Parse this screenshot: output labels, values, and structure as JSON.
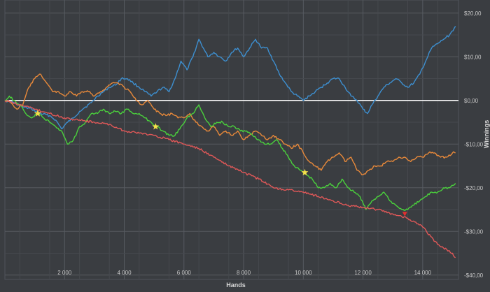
{
  "chart_data": {
    "type": "line",
    "title": "",
    "xlabel": "Hands",
    "ylabel": "Winnings",
    "xlim": [
      0,
      15200
    ],
    "ylim": [
      -41,
      23
    ],
    "x_ticks": [
      2000,
      4000,
      6000,
      8000,
      10000,
      12000,
      14000
    ],
    "x_tick_labels": [
      "2 000",
      "4 000",
      "6 000",
      "8 000",
      "10 000",
      "12 000",
      "14 000"
    ],
    "y_ticks": [
      20,
      10,
      0,
      -10,
      -20,
      -30,
      -40
    ],
    "y_tick_labels": [
      "$20,00",
      "$10,00",
      "$0,00",
      "-$10,00",
      "-$20,00",
      "-$30,00",
      "-$40,00"
    ],
    "grid": true,
    "zero_line_color": "#ffffff",
    "background": "#3a3d41",
    "series": [
      {
        "color": "#3d8fd0",
        "points": [
          [
            0,
            0
          ],
          [
            300,
            -0.5
          ],
          [
            600,
            -1.5
          ],
          [
            900,
            -2
          ],
          [
            1200,
            -3
          ],
          [
            1500,
            -3.5
          ],
          [
            1700,
            -4.5
          ],
          [
            1900,
            -6.5
          ],
          [
            2100,
            -5
          ],
          [
            2300,
            -4
          ],
          [
            2500,
            -2.5
          ],
          [
            2700,
            -1.5
          ],
          [
            2900,
            -0.5
          ],
          [
            3100,
            1
          ],
          [
            3300,
            2
          ],
          [
            3500,
            3
          ],
          [
            3700,
            3.5
          ],
          [
            3900,
            5
          ],
          [
            4100,
            5
          ],
          [
            4300,
            4
          ],
          [
            4500,
            3
          ],
          [
            4700,
            2
          ],
          [
            4900,
            1
          ],
          [
            5100,
            2
          ],
          [
            5300,
            3
          ],
          [
            5500,
            2
          ],
          [
            5700,
            5
          ],
          [
            5900,
            9
          ],
          [
            6100,
            7
          ],
          [
            6300,
            10
          ],
          [
            6500,
            14
          ],
          [
            6650,
            12
          ],
          [
            6800,
            10
          ],
          [
            7000,
            11
          ],
          [
            7200,
            10
          ],
          [
            7400,
            9
          ],
          [
            7600,
            11
          ],
          [
            7800,
            12
          ],
          [
            8000,
            10
          ],
          [
            8200,
            12
          ],
          [
            8400,
            14
          ],
          [
            8600,
            12
          ],
          [
            8800,
            12
          ],
          [
            9000,
            9
          ],
          [
            9200,
            6
          ],
          [
            9400,
            4
          ],
          [
            9600,
            2
          ],
          [
            9800,
            1
          ],
          [
            10000,
            0
          ],
          [
            10200,
            1
          ],
          [
            10400,
            2
          ],
          [
            10600,
            3
          ],
          [
            10800,
            4
          ],
          [
            11000,
            5
          ],
          [
            11200,
            5
          ],
          [
            11400,
            3
          ],
          [
            11600,
            1
          ],
          [
            11800,
            0
          ],
          [
            12000,
            -2
          ],
          [
            12150,
            -3
          ],
          [
            12300,
            -1
          ],
          [
            12500,
            1
          ],
          [
            12700,
            3
          ],
          [
            12900,
            4
          ],
          [
            13100,
            5
          ],
          [
            13300,
            4
          ],
          [
            13500,
            3
          ],
          [
            13700,
            4
          ],
          [
            13900,
            6
          ],
          [
            14100,
            9
          ],
          [
            14300,
            12
          ],
          [
            14500,
            13
          ],
          [
            14700,
            14
          ],
          [
            14900,
            15
          ],
          [
            15100,
            17
          ]
        ]
      },
      {
        "color": "#e8893a",
        "points": [
          [
            0,
            0
          ],
          [
            200,
            -0.5
          ],
          [
            400,
            -2
          ],
          [
            600,
            -1
          ],
          [
            800,
            3
          ],
          [
            1000,
            5
          ],
          [
            1200,
            6
          ],
          [
            1400,
            4
          ],
          [
            1600,
            2
          ],
          [
            1800,
            2
          ],
          [
            2000,
            1
          ],
          [
            2200,
            2
          ],
          [
            2400,
            1
          ],
          [
            2600,
            2
          ],
          [
            2800,
            2
          ],
          [
            3000,
            1
          ],
          [
            3200,
            2
          ],
          [
            3400,
            3
          ],
          [
            3600,
            4
          ],
          [
            3800,
            4
          ],
          [
            4000,
            3
          ],
          [
            4200,
            2
          ],
          [
            4400,
            0
          ],
          [
            4600,
            -1
          ],
          [
            4800,
            0
          ],
          [
            5000,
            -2
          ],
          [
            5200,
            -3
          ],
          [
            5400,
            -3.5
          ],
          [
            5600,
            -3
          ],
          [
            5800,
            -4
          ],
          [
            6000,
            -4
          ],
          [
            6200,
            -3
          ],
          [
            6400,
            -5
          ],
          [
            6600,
            -6
          ],
          [
            6800,
            -7
          ],
          [
            7000,
            -6
          ],
          [
            7200,
            -8
          ],
          [
            7400,
            -7
          ],
          [
            7600,
            -8
          ],
          [
            7800,
            -7
          ],
          [
            8000,
            -9
          ],
          [
            8200,
            -8
          ],
          [
            8400,
            -7
          ],
          [
            8600,
            -8
          ],
          [
            8800,
            -9
          ],
          [
            9000,
            -8
          ],
          [
            9200,
            -9
          ],
          [
            9400,
            -10
          ],
          [
            9600,
            -11
          ],
          [
            9800,
            -10
          ],
          [
            10000,
            -12
          ],
          [
            10200,
            -14
          ],
          [
            10400,
            -15
          ],
          [
            10600,
            -16
          ],
          [
            10800,
            -14
          ],
          [
            11000,
            -13
          ],
          [
            11200,
            -12
          ],
          [
            11400,
            -14
          ],
          [
            11600,
            -13
          ],
          [
            11800,
            -16
          ],
          [
            12000,
            -17
          ],
          [
            12200,
            -16
          ],
          [
            12400,
            -15
          ],
          [
            12600,
            -15
          ],
          [
            12800,
            -14
          ],
          [
            13000,
            -14
          ],
          [
            13200,
            -13
          ],
          [
            13400,
            -13
          ],
          [
            13600,
            -14
          ],
          [
            13800,
            -13
          ],
          [
            14000,
            -13
          ],
          [
            14200,
            -12
          ],
          [
            14400,
            -12
          ],
          [
            14600,
            -13
          ],
          [
            14800,
            -13
          ],
          [
            15000,
            -12
          ],
          [
            15100,
            -12
          ]
        ]
      },
      {
        "color": "#4ad13c",
        "points": [
          [
            0,
            0
          ],
          [
            150,
            1
          ],
          [
            300,
            0
          ],
          [
            500,
            -1
          ],
          [
            700,
            -3
          ],
          [
            900,
            -4
          ],
          [
            1100,
            -3
          ],
          [
            1300,
            -4
          ],
          [
            1500,
            -5
          ],
          [
            1700,
            -6
          ],
          [
            1900,
            -7
          ],
          [
            2100,
            -10
          ],
          [
            2300,
            -9
          ],
          [
            2500,
            -6
          ],
          [
            2700,
            -5
          ],
          [
            2900,
            -3
          ],
          [
            3100,
            -3
          ],
          [
            3300,
            -2
          ],
          [
            3500,
            -3
          ],
          [
            3700,
            -2.5
          ],
          [
            3900,
            -3
          ],
          [
            4100,
            -2
          ],
          [
            4300,
            -3
          ],
          [
            4500,
            -3
          ],
          [
            4700,
            -4
          ],
          [
            4900,
            -5
          ],
          [
            5100,
            -6
          ],
          [
            5300,
            -7
          ],
          [
            5500,
            -8
          ],
          [
            5700,
            -8
          ],
          [
            5900,
            -6
          ],
          [
            6100,
            -4
          ],
          [
            6300,
            -3
          ],
          [
            6500,
            -1
          ],
          [
            6700,
            -4
          ],
          [
            6900,
            -6
          ],
          [
            7100,
            -5
          ],
          [
            7300,
            -5
          ],
          [
            7500,
            -6
          ],
          [
            7700,
            -6
          ],
          [
            7900,
            -7
          ],
          [
            8100,
            -7
          ],
          [
            8300,
            -8
          ],
          [
            8500,
            -9
          ],
          [
            8700,
            -10
          ],
          [
            8900,
            -10
          ],
          [
            9100,
            -9
          ],
          [
            9300,
            -11
          ],
          [
            9500,
            -13
          ],
          [
            9700,
            -15
          ],
          [
            9900,
            -16
          ],
          [
            10100,
            -17
          ],
          [
            10300,
            -18
          ],
          [
            10500,
            -20
          ],
          [
            10700,
            -20
          ],
          [
            10900,
            -19
          ],
          [
            11100,
            -20
          ],
          [
            11300,
            -18
          ],
          [
            11500,
            -20
          ],
          [
            11700,
            -21
          ],
          [
            11900,
            -22
          ],
          [
            12100,
            -25
          ],
          [
            12300,
            -23
          ],
          [
            12500,
            -22
          ],
          [
            12700,
            -21
          ],
          [
            12900,
            -23
          ],
          [
            13100,
            -24
          ],
          [
            13300,
            -25
          ],
          [
            13500,
            -25
          ],
          [
            13700,
            -24
          ],
          [
            13900,
            -23
          ],
          [
            14100,
            -22
          ],
          [
            14300,
            -21
          ],
          [
            14500,
            -21
          ],
          [
            14700,
            -20
          ],
          [
            14900,
            -20
          ],
          [
            15100,
            -19
          ]
        ]
      },
      {
        "color": "#e05858",
        "points": [
          [
            0,
            0
          ],
          [
            500,
            -1
          ],
          [
            1000,
            -2
          ],
          [
            1500,
            -3
          ],
          [
            2000,
            -4
          ],
          [
            2500,
            -4.5
          ],
          [
            3000,
            -5
          ],
          [
            3500,
            -5.5
          ],
          [
            4000,
            -7
          ],
          [
            4500,
            -7.5
          ],
          [
            5000,
            -8
          ],
          [
            5500,
            -9
          ],
          [
            6000,
            -10
          ],
          [
            6500,
            -11
          ],
          [
            7000,
            -13
          ],
          [
            7500,
            -15
          ],
          [
            8000,
            -16.5
          ],
          [
            8500,
            -18
          ],
          [
            9000,
            -20
          ],
          [
            9500,
            -20.5
          ],
          [
            10000,
            -21
          ],
          [
            10500,
            -22
          ],
          [
            11000,
            -23
          ],
          [
            11500,
            -24
          ],
          [
            12000,
            -24.5
          ],
          [
            12500,
            -25
          ],
          [
            13000,
            -26
          ],
          [
            13500,
            -27
          ],
          [
            14000,
            -29
          ],
          [
            14500,
            -33
          ],
          [
            15000,
            -35
          ],
          [
            15100,
            -36
          ]
        ]
      }
    ],
    "annotations": [
      {
        "shape": "star",
        "color": "#f5e04a",
        "x": 1100,
        "y": -3
      },
      {
        "shape": "star",
        "color": "#f5e04a",
        "x": 5050,
        "y": -6
      },
      {
        "shape": "star",
        "color": "#f5e04a",
        "x": 10050,
        "y": -16.5
      },
      {
        "shape": "triangle-down",
        "color": "#e03030",
        "x": 13400,
        "y": -26
      }
    ]
  }
}
